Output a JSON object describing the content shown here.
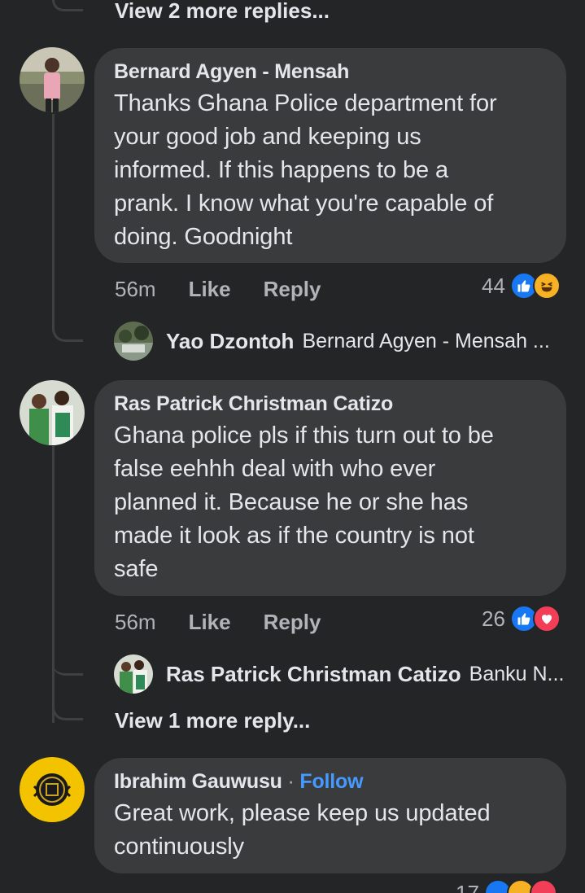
{
  "top": {
    "more_replies": "View 2 more replies..."
  },
  "comments": [
    {
      "author": "Bernard Agyen - Mensah",
      "text_lines": [
        "Thanks Ghana Police department for",
        "your good job and keeping us",
        "informed. If this happens to be a",
        "prank. I know what you're capable of",
        "doing. Goodnight"
      ],
      "time": "56m",
      "like_label": "Like",
      "reply_label": "Reply",
      "reaction_count": "44",
      "reactions": [
        "like-icon",
        "haha-icon"
      ],
      "reply_preview": {
        "name": "Yao Dzontoh",
        "text": "Bernard Agyen - Mensah ..."
      }
    },
    {
      "author": "Ras Patrick Christman Catizo",
      "text_lines": [
        "Ghana police pls if this turn out to be",
        "false eehhh deal with who ever",
        "planned it. Because he or she has",
        "made it look as if the country is not",
        "safe"
      ],
      "time": "56m",
      "like_label": "Like",
      "reply_label": "Reply",
      "reaction_count": "26",
      "reactions": [
        "like-icon",
        "love-icon"
      ],
      "reply_preview": {
        "name": "Ras Patrick Christman Catizo",
        "text": "Banku N..."
      },
      "more_replies": "View 1 more reply..."
    },
    {
      "author": "Ibrahim Gauwusu",
      "separator": "·",
      "follow_label": "Follow",
      "text_lines": [
        "Great work, please keep us updated",
        "continuously"
      ],
      "reaction_count": "17",
      "reactions": [
        "like-icon",
        "haha-icon",
        "love-icon"
      ]
    }
  ],
  "colors": {
    "background": "#242526",
    "bubble": "#3a3b3c",
    "primary_text": "#e4e6eb",
    "secondary_text": "#b0b3b8",
    "link": "#4599ff",
    "like": "#1877f2",
    "love": "#f33e58",
    "haha": "#f7b125"
  }
}
